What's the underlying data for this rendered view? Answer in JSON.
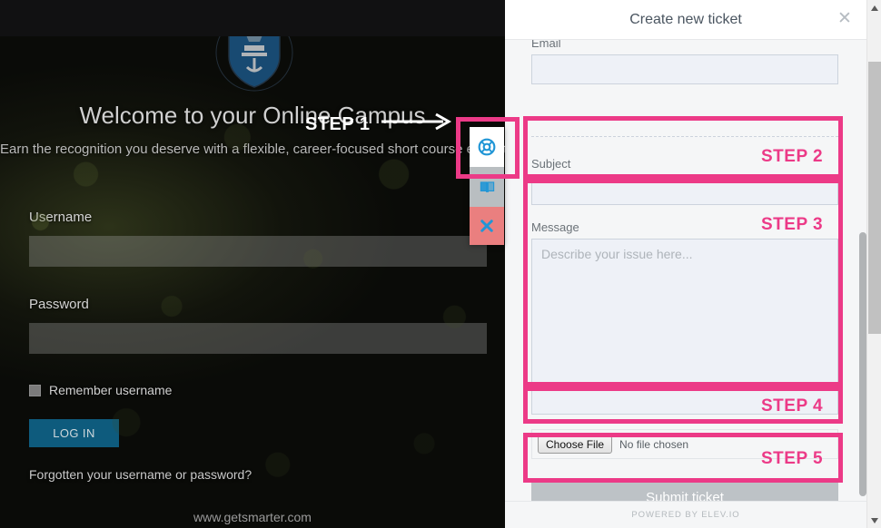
{
  "campus": {
    "headline": "Welcome to your Online Campus",
    "subhead": "Earn the recognition you deserve with a flexible, career-focused short course education.",
    "username_label": "Username",
    "username_value": "",
    "password_label": "Password",
    "password_value": "",
    "remember_label": "Remember username",
    "login_label": "LOG IN",
    "forgot_label": "Forgotten your username or password?",
    "site_url": "www.getsmarter.com",
    "logo_name": "university-crest"
  },
  "launcher": {
    "support_icon": "lifebuoy-icon",
    "knowledgebase_icon": "book-icon",
    "close_icon": "x-icon",
    "icon_color": "#2196d6",
    "close_bg": "#ea7f7f"
  },
  "panel": {
    "title": "Create new ticket",
    "close_icon": "close-icon",
    "email_label": "Email",
    "email_value": "",
    "email_placeholder": "",
    "subject_label": "Subject",
    "subject_value": "",
    "subject_placeholder": "",
    "message_label": "Message",
    "message_value": "",
    "message_placeholder": "Describe your issue here...",
    "file_button_label": "Choose File",
    "file_status": "No file chosen",
    "submit_label": "Submit ticket",
    "footer": "POWERED BY ELEV.IO"
  },
  "annotations": {
    "accent_color": "#ec3a87",
    "step1": "STEP 1",
    "step2": "STEP 2",
    "step3": "STEP 3",
    "step4": "STEP 4",
    "step5": "STEP 5"
  }
}
